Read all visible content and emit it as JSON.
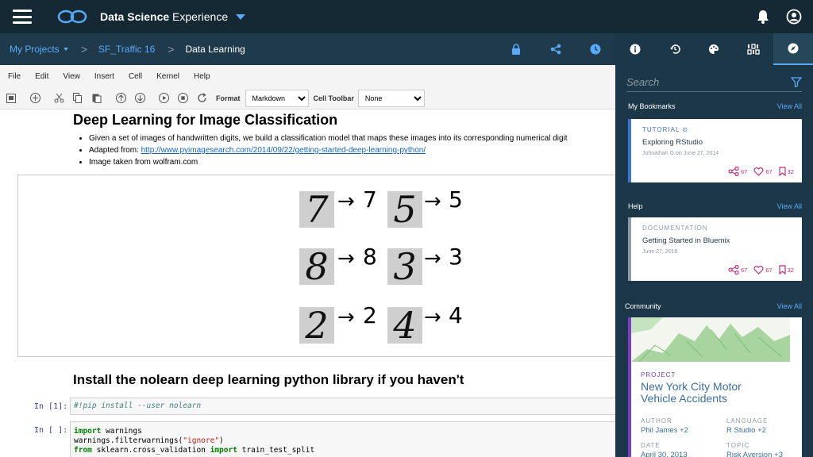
{
  "app": {
    "brand_bold": "Data Science",
    "brand_light": " Experience"
  },
  "breadcrumb": {
    "project": "My Projects",
    "sep1": ">",
    "folder": "SF_Traffic 16",
    "sep2": ">",
    "notebook": "Data Learning"
  },
  "menu": [
    "File",
    "Edit",
    "View",
    "Insert",
    "Cell",
    "Kernel",
    "Help"
  ],
  "toolbar": {
    "format_label": "Format",
    "format_value": "Markdown",
    "cell_toolbar_label": "Cell Toolbar",
    "cell_toolbar_value": "None"
  },
  "notebook": {
    "heading1": "Deep Learning for Image Classification",
    "bullets": [
      "Given a set of images of handwritten digits, we build a classification model that maps these images into its corresponding numerical digit",
      "Adapted from: ",
      "Image taken from wolfram.com"
    ],
    "link": "http://www.pyimagesearch.com/2014/09/22/getting-started-deep-learning-python/",
    "digits": [
      {
        "img": "7",
        "label": "7"
      },
      {
        "img": "5",
        "label": "5"
      },
      {
        "img": "8",
        "label": "8"
      },
      {
        "img": "3",
        "label": "3"
      },
      {
        "img": "2",
        "label": "2"
      },
      {
        "img": "4",
        "label": "4"
      }
    ],
    "arrow": "→",
    "heading2": "Install the nolearn deep learning python library if you haven't",
    "cell1_prompt": "In [1]:",
    "cell1_code": "#!pip install --user nolearn",
    "cell2_prompt": "In [ ]:",
    "cell2_lines": [
      {
        "kw": "import",
        "rest": " warnings"
      },
      {
        "pre": "warnings.filterwarnings(",
        "str": "\"ignore\"",
        "post": ")"
      },
      {
        "kw": "from",
        "rest": " sklearn.cross_validation ",
        "kw2": "import",
        "rest2": " train_test_split"
      }
    ]
  },
  "panel": {
    "search_placeholder": "Search",
    "bookmarks_title": "My Bookmarks",
    "bookmarks_view": "View All",
    "bookmark": {
      "type": "TUTORIAL",
      "title": "Exploring RStudio",
      "meta": "Johnathan G on June 27, 2014",
      "shares": "67",
      "likes": "67",
      "saves": "32",
      "stripe": "#3b73d9"
    },
    "help_title": "Help",
    "help_view": "View All",
    "help_card": {
      "type": "DOCUMENTATION",
      "title": "Getting Started in Bluemix",
      "meta": "June 27, 2016",
      "shares": "67",
      "likes": "67",
      "saves": "32",
      "stripe": "#8c9ba5"
    },
    "community_title": "Community",
    "community_view": "View All",
    "project": {
      "type": "PROJECT",
      "title_line1": "New York City Motor",
      "title_line2": "Vehicle Accidents",
      "author_label": "AUTHOR",
      "author": "Phil James +2",
      "language_label": "LANGUAGE",
      "language": "R Studio +2",
      "date_label": "DATE",
      "date": "April 30, 2013",
      "topic_label": "TOPIC",
      "topic": "Risk Aversion +3"
    }
  },
  "colors": {
    "topbar": "#152935",
    "accent": "#5aaafa",
    "panel": "#1c3748",
    "pink": "#c12f7b",
    "purple": "#7c3dcc"
  }
}
